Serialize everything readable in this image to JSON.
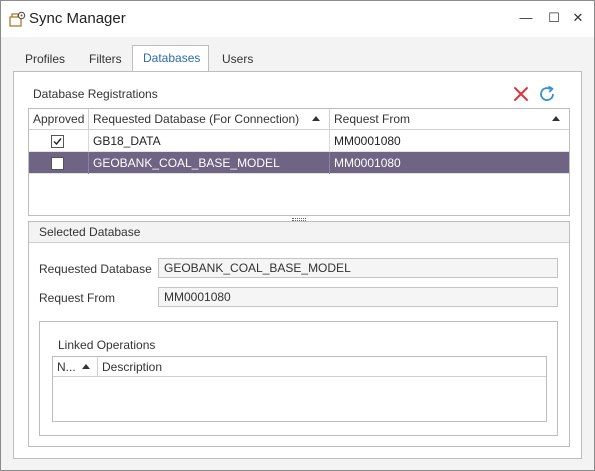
{
  "window": {
    "title": "Sync Manager",
    "minimize_glyph": "—",
    "maximize_glyph": "☐",
    "close_glyph": "✕"
  },
  "tabs": [
    {
      "label": "Profiles",
      "active": false
    },
    {
      "label": "Filters",
      "active": false
    },
    {
      "label": "Databases",
      "active": true
    },
    {
      "label": "Users",
      "active": false
    }
  ],
  "database_registrations": {
    "title": "Database Registrations",
    "actions": {
      "delete_icon": "red-x-icon",
      "refresh_icon": "refresh-icon"
    },
    "columns": {
      "approved": "Approved",
      "requested_database": "Requested Database (For Connection)",
      "request_from": "Request From"
    },
    "rows": [
      {
        "approved": true,
        "requested_database": "GB18_DATA",
        "request_from": "MM0001080",
        "selected": false
      },
      {
        "approved": false,
        "requested_database": "GEOBANK_COAL_BASE_MODEL",
        "request_from": "MM0001080",
        "selected": true
      }
    ]
  },
  "selected_database": {
    "title": "Selected Database",
    "requested_database_label": "Requested Database",
    "requested_database_value": "GEOBANK_COAL_BASE_MODEL",
    "request_from_label": "Request From",
    "request_from_value": "MM0001080",
    "linked_operations": {
      "title": "Linked Operations",
      "columns": {
        "no": "N...",
        "description": "Description"
      }
    }
  },
  "colors": {
    "selection": "#6f6484",
    "accent": "#2b6cb0",
    "delete": "#e0353b",
    "refresh": "#3a8fd6"
  }
}
